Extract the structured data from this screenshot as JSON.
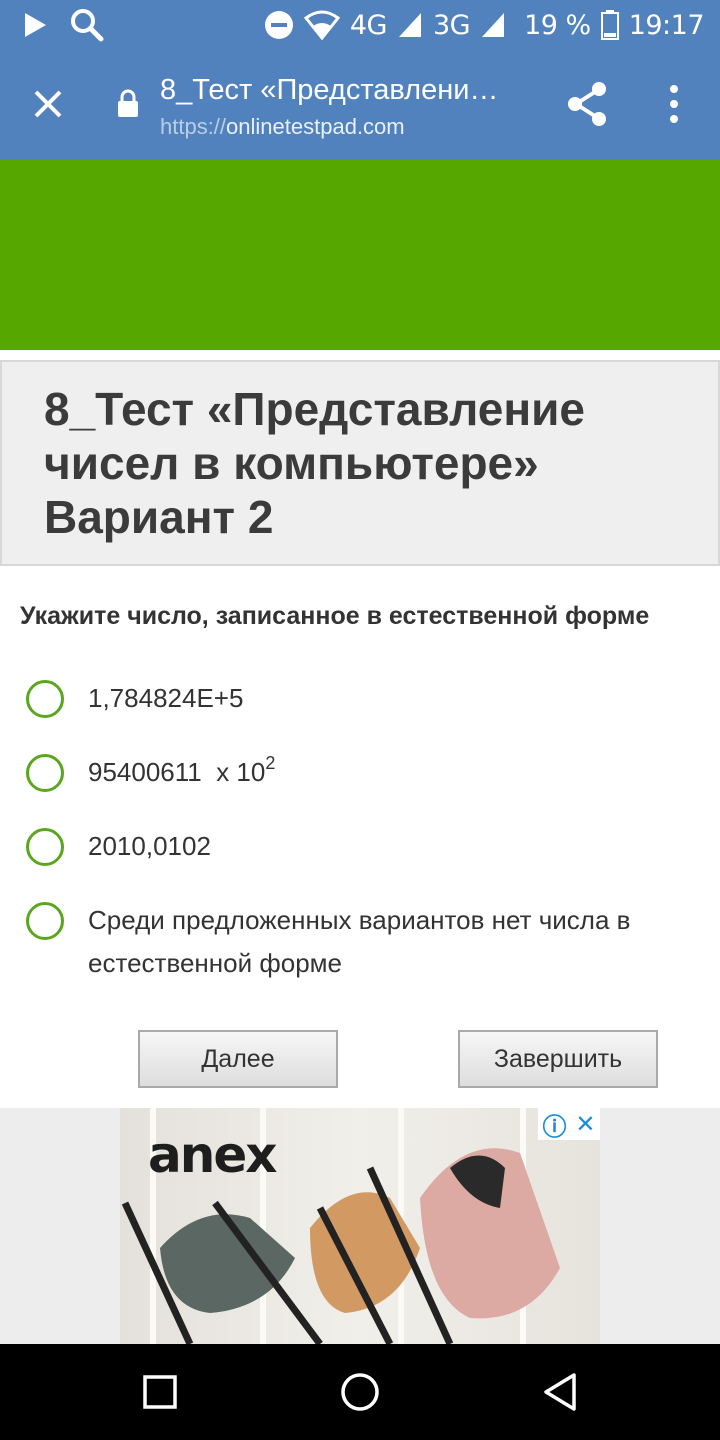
{
  "status_bar": {
    "network_4g": "4G",
    "network_3g": "3G",
    "battery": "19 %",
    "time": "19:17",
    "icons": [
      "play-icon",
      "search-icon",
      "do-not-disturb-icon",
      "wifi-icon",
      "signal-icon",
      "battery-icon"
    ]
  },
  "toolbar": {
    "title": "8_Тест «Представлени…",
    "url_protocol": "https://",
    "url_host": "onlinetestpad.com"
  },
  "colors": {
    "toolbar_bg": "#5182be",
    "banner_green": "#56a800",
    "radio_green": "#5aa61e"
  },
  "page": {
    "title": "8_Тест «Представление чисел в компьютере» Вариант 2",
    "question": "Укажите число, записанное в естественной форме",
    "options": [
      {
        "text": "1,784824E+5"
      },
      {
        "text": "95400611  x 10",
        "sup": "2"
      },
      {
        "text": "2010,0102"
      },
      {
        "text": "Среди предложенных вариантов нет числа в естественной форме"
      }
    ],
    "next_button": "Далее",
    "finish_button": "Завершить"
  },
  "ad": {
    "logo": "anex",
    "info_icon": "ⓘ",
    "close_icon": "✕"
  }
}
